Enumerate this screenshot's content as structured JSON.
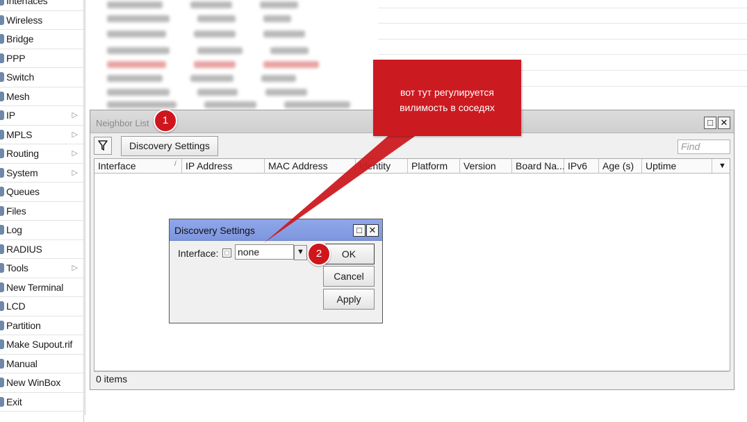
{
  "sidebar": {
    "items": [
      {
        "label": "Interfaces",
        "icon": "interfaces-icon",
        "submenu": false
      },
      {
        "label": "Wireless",
        "icon": "wireless-icon",
        "submenu": false
      },
      {
        "label": "Bridge",
        "icon": "bridge-icon",
        "submenu": false
      },
      {
        "label": "PPP",
        "icon": "ppp-icon",
        "submenu": false
      },
      {
        "label": "Switch",
        "icon": "switch-icon",
        "submenu": false
      },
      {
        "label": "Mesh",
        "icon": "mesh-icon",
        "submenu": false
      },
      {
        "label": "IP",
        "icon": "ip-icon",
        "submenu": true
      },
      {
        "label": "MPLS",
        "icon": "mpls-icon",
        "submenu": true
      },
      {
        "label": "Routing",
        "icon": "routing-icon",
        "submenu": true
      },
      {
        "label": "System",
        "icon": "system-icon",
        "submenu": true
      },
      {
        "label": "Queues",
        "icon": "queues-icon",
        "submenu": false
      },
      {
        "label": "Files",
        "icon": "files-icon",
        "submenu": false
      },
      {
        "label": "Log",
        "icon": "log-icon",
        "submenu": false
      },
      {
        "label": "RADIUS",
        "icon": "radius-icon",
        "submenu": false
      },
      {
        "label": "Tools",
        "icon": "tools-icon",
        "submenu": true
      },
      {
        "label": "New Terminal",
        "icon": "terminal-icon",
        "submenu": false
      },
      {
        "label": "LCD",
        "icon": "lcd-icon",
        "submenu": false
      },
      {
        "label": "Partition",
        "icon": "partition-icon",
        "submenu": false
      },
      {
        "label": "Make Supout.rif",
        "icon": "supout-icon",
        "submenu": false
      },
      {
        "label": "Manual",
        "icon": "manual-icon",
        "submenu": false
      },
      {
        "label": "New WinBox",
        "icon": "winbox-icon",
        "submenu": false
      },
      {
        "label": "Exit",
        "icon": "exit-icon",
        "submenu": false
      }
    ]
  },
  "neighbor_window": {
    "title": "Neighbor List",
    "discovery_button": "Discovery Settings",
    "find_placeholder": "Find",
    "columns": [
      "Interface",
      "IP Address",
      "MAC Address",
      "Identity",
      "Platform",
      "Version",
      "Board Na...",
      "IPv6",
      "Age (s)",
      "Uptime"
    ],
    "sort_indicator": "/",
    "status": "0 items"
  },
  "discovery_dialog": {
    "title": "Discovery Settings",
    "interface_label": "Interface:",
    "interface_value": "none",
    "ok": "OK",
    "cancel": "Cancel",
    "apply": "Apply"
  },
  "annotations": {
    "marker1": "1",
    "marker2": "2",
    "callout": "вот тут  регулируется\nвилимость в соседях",
    "accent_color": "#cc1a21"
  },
  "colors": {
    "dialog_title": "#8fa7ea",
    "window_bg": "#f0f0f0"
  }
}
